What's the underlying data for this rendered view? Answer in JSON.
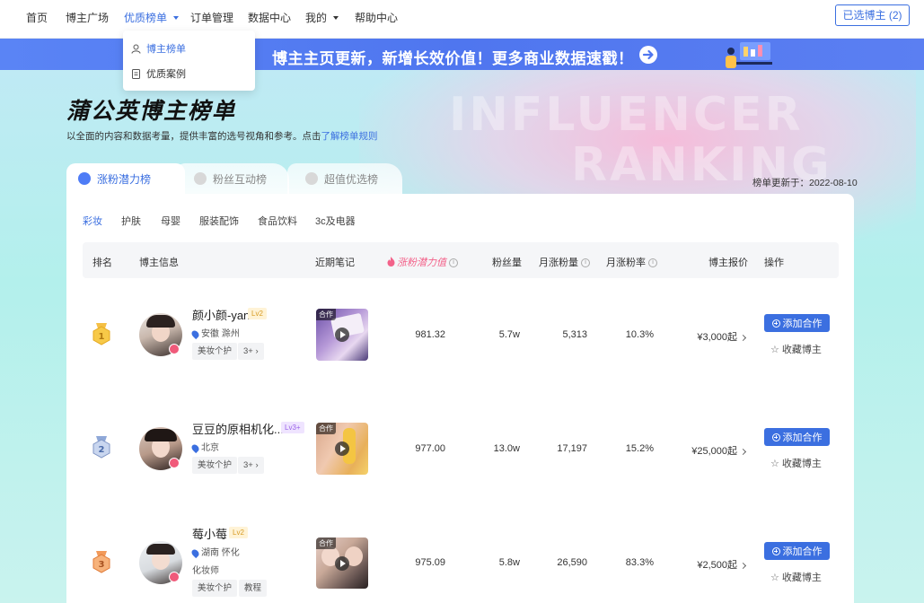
{
  "nav": {
    "items": [
      "首页",
      "博主广场",
      "优质榜单",
      "订单管理",
      "数据中心",
      "我的",
      "帮助中心"
    ],
    "selected_button": "已选博主 (2)"
  },
  "dropdown": {
    "items": [
      "博主榜单",
      "优质案例"
    ]
  },
  "banner": {
    "text": "博主主页更新，新增长效价值！更多商业数据速戳！"
  },
  "hero": {
    "watermark_line1": "INFLUENCER",
    "watermark_line2": "RANKING",
    "title": "蒲公英博主榜单",
    "desc": "以全面的内容和数据考量，提供丰富的选号视角和参考。点击",
    "desc_link": "了解榜单规则",
    "update_time": "榜单更新于：2022-08-10"
  },
  "tabs": [
    "涨粉潜力榜",
    "粉丝互动榜",
    "超值优选榜"
  ],
  "categories": [
    "彩妆",
    "护肤",
    "母婴",
    "服装配饰",
    "食品饮料",
    "3c及电器"
  ],
  "table": {
    "headers": [
      "排名",
      "博主信息",
      "近期笔记",
      "涨粉潜力值",
      "粉丝量",
      "月涨粉量",
      "月涨粉率",
      "博主报价",
      "操作"
    ],
    "note_tag": "合作",
    "add_label": "添加合作",
    "fav_label": "收藏博主",
    "rows": [
      {
        "rank": "1",
        "name": "颜小颜-yan",
        "level": "Lv2",
        "location": "安徽 滁州",
        "extra": "",
        "tags": [
          "美妆个护",
          "3+"
        ],
        "potential": "981.32",
        "fans": "5.7w",
        "monthly_gain": "5,313",
        "monthly_rate": "10.3%",
        "price": "¥3,000起"
      },
      {
        "rank": "2",
        "name": "豆豆的原相机化...",
        "level": "Lv3+",
        "location": "北京",
        "extra": "",
        "tags": [
          "美妆个护",
          "3+"
        ],
        "potential": "977.00",
        "fans": "13.0w",
        "monthly_gain": "17,197",
        "monthly_rate": "15.2%",
        "price": "¥25,000起"
      },
      {
        "rank": "3",
        "name": "莓小莓",
        "level": "Lv2",
        "location": "湖南 怀化",
        "extra": "化妆师",
        "tags": [
          "美妆个护",
          "教程"
        ],
        "potential": "975.09",
        "fans": "5.8w",
        "monthly_gain": "26,590",
        "monthly_rate": "83.3%",
        "price": "¥2,500起"
      }
    ]
  },
  "colors": {
    "accent": "#3b6fe0",
    "banner": "#4f76ef",
    "potential": "#f3628a"
  }
}
